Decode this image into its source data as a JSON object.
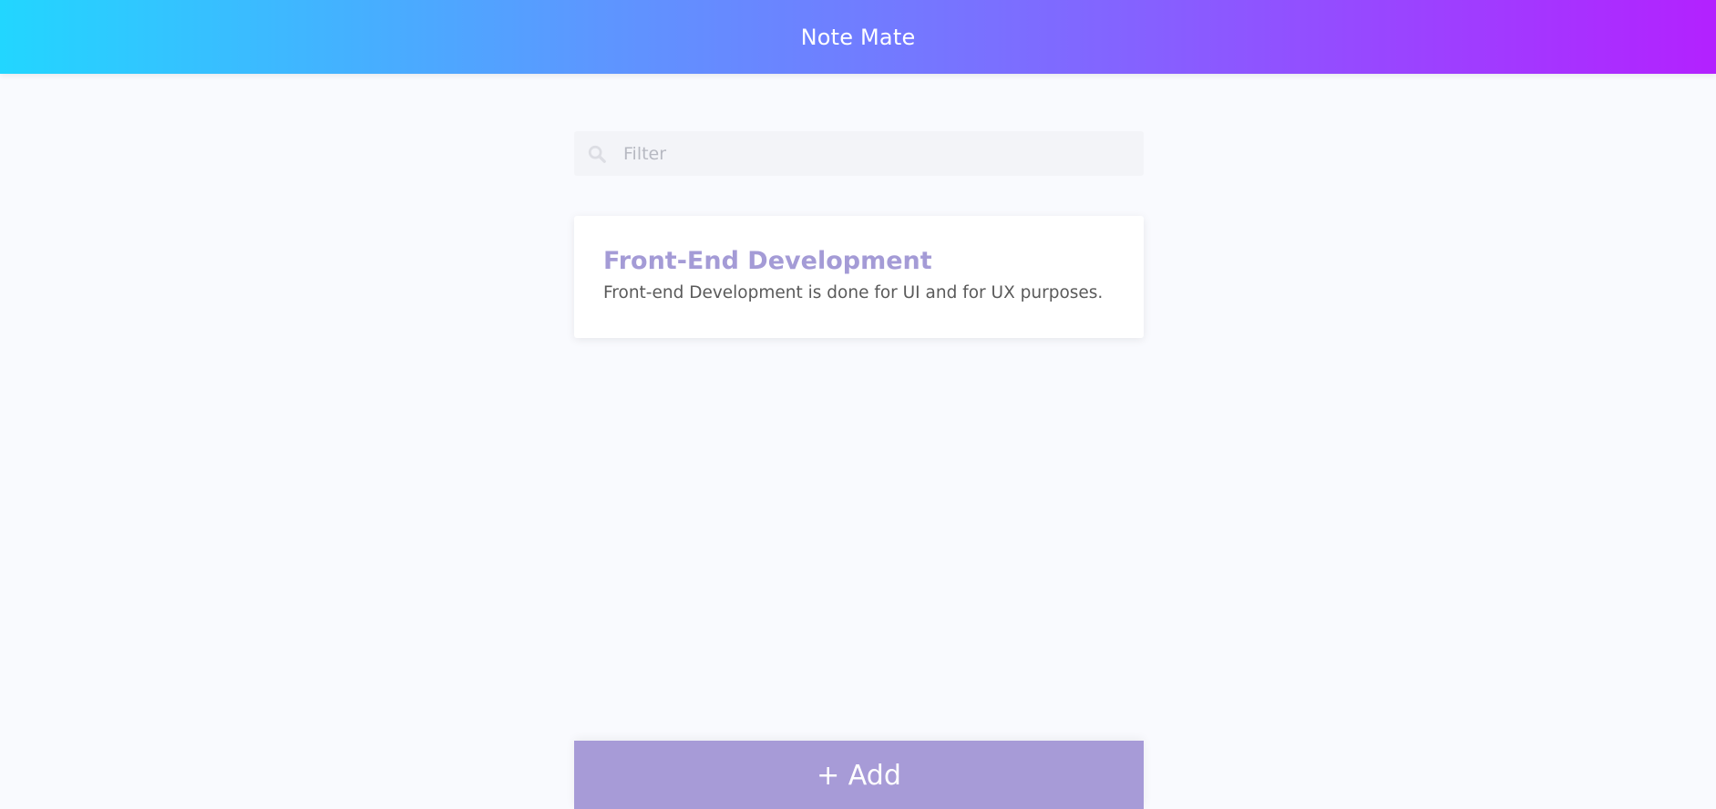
{
  "app": {
    "title": "Note Mate"
  },
  "filter": {
    "placeholder": "Filter",
    "value": "",
    "icon": "search-icon"
  },
  "notes": [
    {
      "title": "Front-End Development",
      "body": "Front-end Development is done for UI and for UX purposes."
    }
  ],
  "actions": {
    "add_label": "+ Add"
  },
  "colors": {
    "header_gradient": [
      "#22d6ff",
      "#5d96ff",
      "#8364ff",
      "#b321ff"
    ],
    "accent": "#a79bd7",
    "background": "#f9fafe"
  }
}
